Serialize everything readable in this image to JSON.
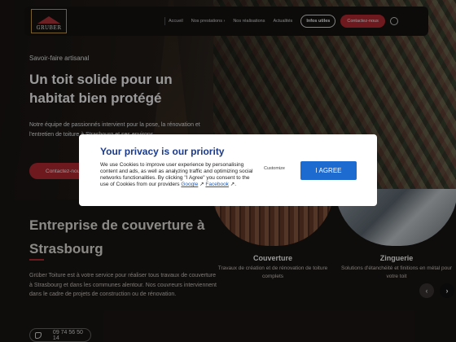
{
  "header": {
    "logo_text": "GRUBER",
    "nav": [
      {
        "label": "Accueil"
      },
      {
        "label": "Nos prestations ›"
      },
      {
        "label": "Nos réalisations"
      },
      {
        "label": "Actualités"
      }
    ],
    "infos_label": "Infos utiles",
    "contact_label": "Contactez-nous"
  },
  "hero": {
    "kicker": "Savoir-faire artisanal",
    "title": "Un toit solide pour un habitat bien protégé",
    "description": "Notre équipe de passionnés intervient pour la pose, la rénovation et l'entretien de toiture à Strasbourg et ses environs.",
    "button_label": "Contactez-nous"
  },
  "section": {
    "title": "Entreprise de couverture à Strasbourg",
    "description": "Grüber Toiture est à votre service pour réaliser tous travaux de couverture à Strasbourg et dans les communes alentour. Nos couvreurs interviennent dans le cadre de projets de construction ou de rénovation.",
    "phone": "09 74 56 50 14"
  },
  "services": [
    {
      "title": "Couverture",
      "description": "Travaux de création et de rénovation de toiture complets"
    },
    {
      "title": "Zinguerie",
      "description": "Solutions d'étanchéité et finitions en métal pour votre toit"
    }
  ],
  "carousel": {
    "prev_icon": "‹",
    "next_icon": "›"
  },
  "consent": {
    "title": "Your privacy is our priority",
    "body": "We use Cookies to improve user experience by personalising content and ads, as well as analyzing traffic and optimizing social networks functionalities. By clicking \"I Agree\" you consent to the use of Cookies from our providers",
    "link_google": "Google",
    "link_facebook": "Facebook",
    "customize_label": "Customize",
    "agree_label": "I AGREE"
  }
}
